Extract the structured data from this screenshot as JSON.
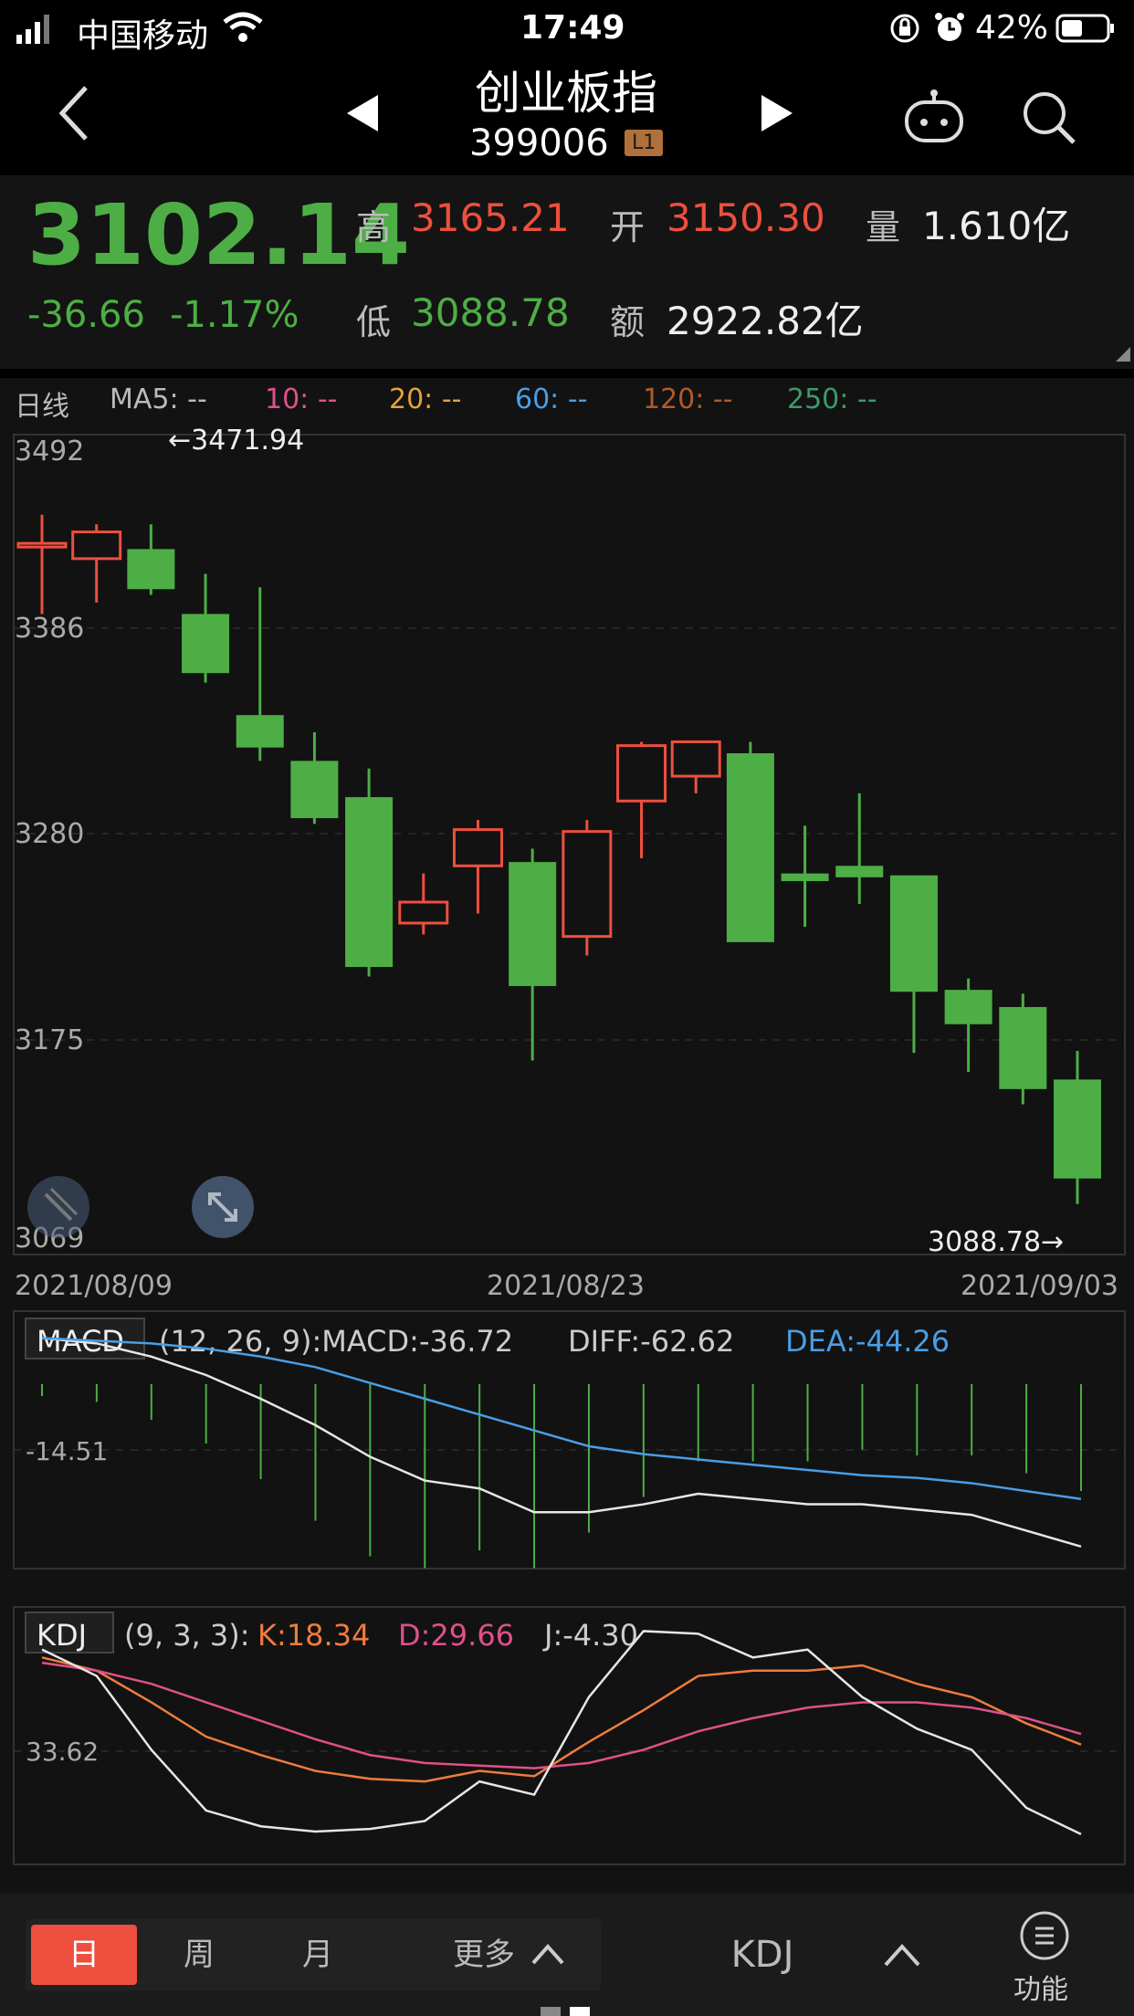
{
  "status": {
    "carrier": "中国移动",
    "time": "17:49",
    "battery": "42%"
  },
  "nav": {
    "title": "创业板指",
    "code": "399006",
    "level_badge": "L1",
    "icons": [
      "back-icon",
      "prev-arrow-icon",
      "next-arrow-icon",
      "robot-icon",
      "search-icon"
    ]
  },
  "quote": {
    "price": "3102.14",
    "change": "-36.66",
    "change_pct": "-1.17%",
    "high_label": "高",
    "high": "3165.21",
    "open_label": "开",
    "open": "3150.30",
    "vol_label": "量",
    "volume": "1.610亿",
    "low_label": "低",
    "low": "3088.78",
    "amt_label": "额",
    "amount": "2922.82亿"
  },
  "ma_legend": {
    "period": "日线",
    "ma5": "MA5: --",
    "ma10": "10: --",
    "ma20": "20: --",
    "ma60": "60: --",
    "ma120": "120: --",
    "ma250": "250: --"
  },
  "kline": {
    "y_labels": [
      "3492",
      "3386",
      "3280",
      "3175",
      "3069"
    ],
    "max_label": "←3471.94",
    "min_label": "3088.78→",
    "x_labels": [
      "2021/08/09",
      "2021/08/23",
      "2021/09/03"
    ],
    "colors": {
      "up": "#ee4f3e",
      "down": "#4dae45"
    }
  },
  "chart_data": [
    {
      "type": "candlestick",
      "ylim": [
        3069,
        3492
      ],
      "candles": [
        {
          "o": 3434,
          "h": 3450,
          "l": 3398,
          "c": 3435
        },
        {
          "o": 3427,
          "h": 3445,
          "l": 3404,
          "c": 3441
        },
        {
          "o": 3432,
          "h": 3445,
          "l": 3408,
          "c": 3411
        },
        {
          "o": 3398,
          "h": 3419,
          "l": 3362,
          "c": 3367
        },
        {
          "o": 3345,
          "h": 3412,
          "l": 3321,
          "c": 3328
        },
        {
          "o": 3321,
          "h": 3336,
          "l": 3288,
          "c": 3291
        },
        {
          "o": 3302,
          "h": 3317,
          "l": 3208,
          "c": 3213
        },
        {
          "o": 3236,
          "h": 3262,
          "l": 3230,
          "c": 3247
        },
        {
          "o": 3266,
          "h": 3290,
          "l": 3241,
          "c": 3285
        },
        {
          "o": 3268,
          "h": 3275,
          "l": 3164,
          "c": 3203
        },
        {
          "o": 3229,
          "h": 3290,
          "l": 3219,
          "c": 3284
        },
        {
          "o": 3300,
          "h": 3331,
          "l": 3270,
          "c": 3329
        },
        {
          "o": 3313,
          "h": 3331,
          "l": 3304,
          "c": 3331
        },
        {
          "o": 3325,
          "h": 3331,
          "l": 3227,
          "c": 3226
        },
        {
          "o": 3262,
          "h": 3287,
          "l": 3234,
          "c": 3258
        },
        {
          "o": 3266,
          "h": 3304,
          "l": 3246,
          "c": 3260
        },
        {
          "o": 3261,
          "h": 3261,
          "l": 3168,
          "c": 3200
        },
        {
          "o": 3201,
          "h": 3207,
          "l": 3158,
          "c": 3183
        },
        {
          "o": 3192,
          "h": 3199,
          "l": 3141,
          "c": 3149
        },
        {
          "o": 3154,
          "h": 3169,
          "l": 3088.78,
          "c": 3102.14
        }
      ]
    },
    {
      "type": "line",
      "title": "MACD",
      "params": "(12, 26, 9):MACD:-36.72",
      "diff_label": "DIFF:-62.62",
      "dea_label": "DEA:-44.26",
      "ref_label": "-14.51",
      "series": [
        {
          "name": "DIFF",
          "color": "#e6e6e6",
          "values": [
            6,
            4,
            -1,
            -8,
            -17,
            -27,
            -39,
            -48,
            -51,
            -60,
            -60,
            -57,
            -53,
            -55,
            -57,
            -57,
            -59,
            -61,
            -67,
            -73
          ]
        },
        {
          "name": "DEA",
          "color": "#4a9ee6",
          "values": [
            6,
            5,
            4,
            2,
            -1,
            -5,
            -11,
            -17,
            -23,
            -29,
            -35,
            -38,
            -40,
            -42,
            -44,
            -46,
            -47,
            -49,
            -52,
            -55
          ]
        }
      ],
      "bars": [
        -2,
        -3,
        -6,
        -10,
        -16,
        -23,
        -29,
        -31,
        -28,
        -31,
        -25,
        -19,
        -13,
        -13,
        -13,
        -11,
        -12,
        -12,
        -15,
        -18
      ]
    },
    {
      "type": "line",
      "title": "KDJ",
      "params": "(9, 3, 3):",
      "k_label": "K:18.34",
      "d_label": "D:29.66",
      "j_label": "J:-4.30",
      "ref_label": "33.62",
      "series": [
        {
          "name": "K",
          "color": "#ee7c3e",
          "values": [
            85,
            80,
            68,
            55,
            48,
            42,
            39,
            38,
            42,
            40,
            53,
            65,
            78,
            80,
            80,
            82,
            75,
            70,
            60,
            52
          ]
        },
        {
          "name": "D",
          "color": "#e0508a",
          "values": [
            83,
            80,
            75,
            68,
            61,
            54,
            48,
            45,
            44,
            43,
            45,
            50,
            57,
            62,
            66,
            68,
            68,
            66,
            62,
            56
          ]
        },
        {
          "name": "J",
          "color": "#e6e6e6",
          "values": [
            88,
            78,
            50,
            27,
            21,
            19,
            20,
            23,
            38,
            33,
            70,
            95,
            94,
            85,
            88,
            70,
            58,
            50,
            28,
            18
          ]
        }
      ]
    }
  ],
  "tabs": {
    "day": "日",
    "week": "周",
    "month": "月",
    "more": "更多",
    "indicator": "KDJ",
    "func": "功能"
  }
}
